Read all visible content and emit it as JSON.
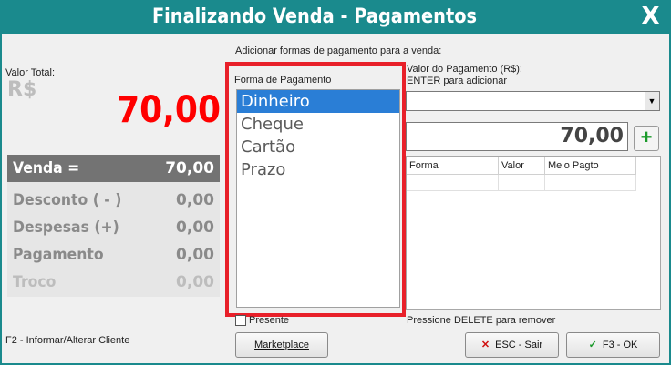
{
  "window": {
    "title": "Finalizando Venda - Pagamentos",
    "close_label": "X"
  },
  "left": {
    "total_label": "Valor Total:",
    "currency": "R$",
    "total_value": "70,00",
    "rows": [
      {
        "label": "Venda =",
        "value": "70,00"
      },
      {
        "label": "Desconto ( - )",
        "value": "0,00"
      },
      {
        "label": "Despesas (+)",
        "value": "0,00"
      },
      {
        "label": "Pagamento",
        "value": "0,00"
      },
      {
        "label": "Troco",
        "value": "0,00"
      }
    ],
    "footer": "F2 - Informar/Alterar Cliente"
  },
  "right": {
    "instruction": "Adicionar formas de pagamento para a venda:",
    "valor_label": "Valor do Pagamento (R$):",
    "enter_hint": "ENTER para adicionar",
    "amount": "70,00",
    "add_label": "+",
    "grid_headers": [
      "Forma",
      "Valor",
      "Meio Pagto"
    ],
    "delete_hint": "Pressione DELETE para remover",
    "presente_label": "Presente"
  },
  "payment_box": {
    "label": "Forma de Pagamento",
    "items": [
      "Dinheiro",
      "Cheque",
      "Cartão",
      "Prazo"
    ],
    "selected": "Dinheiro"
  },
  "buttons": {
    "marketplace": "Marketplace",
    "sair": "ESC - Sair",
    "ok": "F3 - OK"
  },
  "colors": {
    "title_bar": "#1a8a8d",
    "highlight_box": "#e8202a",
    "total": "#ff0000",
    "selection": "#2a7ed6"
  }
}
